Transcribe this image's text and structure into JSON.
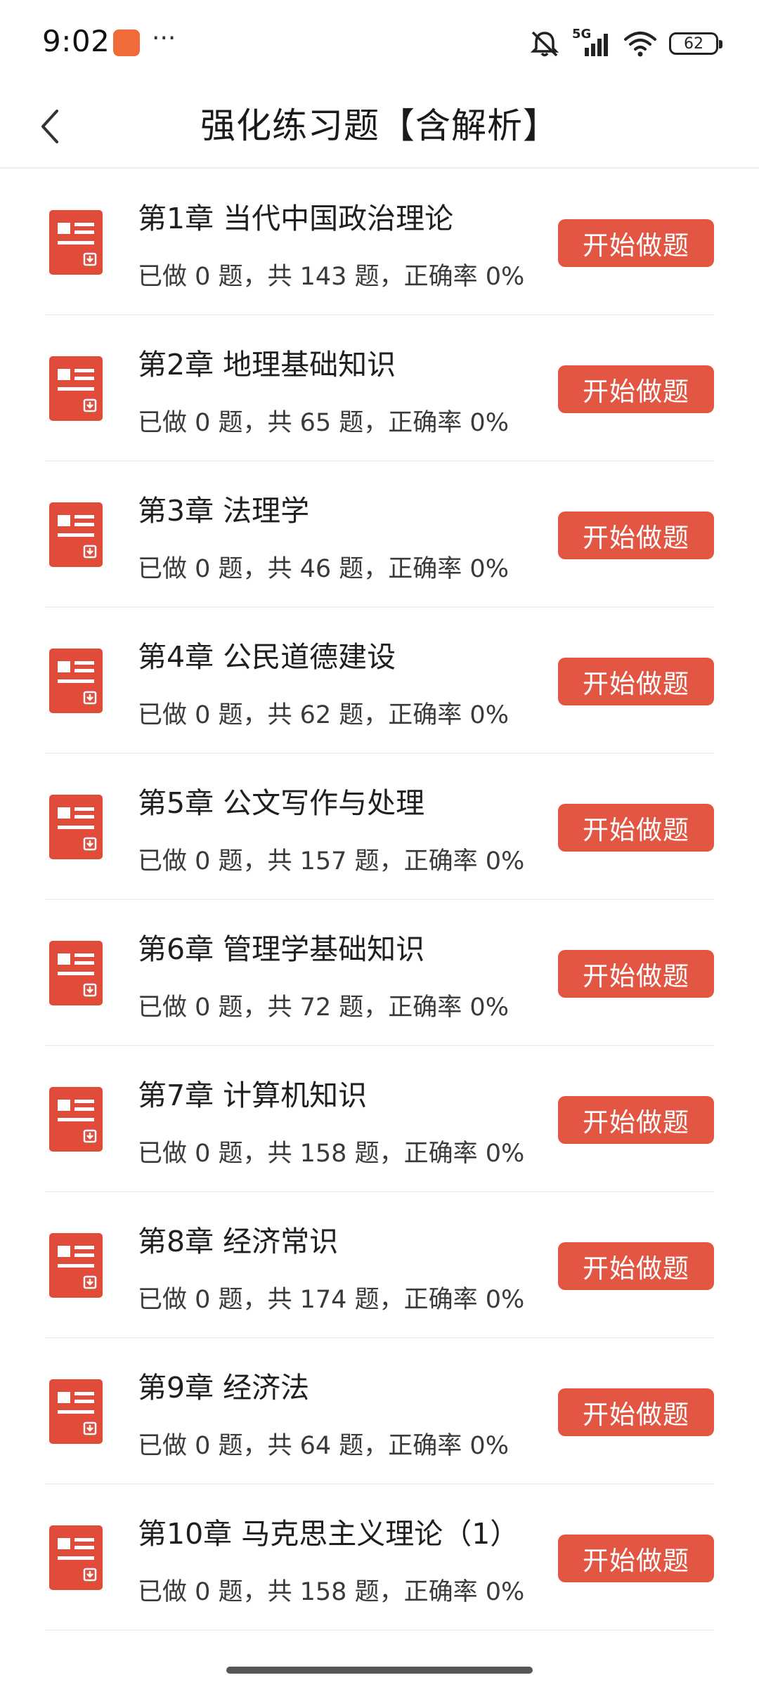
{
  "status_bar": {
    "time": "9:02",
    "more": "···",
    "network": "5G",
    "battery": "62",
    "icons": [
      "app-notification-icon",
      "mute-icon",
      "cellular-signal-icon",
      "wifi-icon",
      "battery-icon"
    ]
  },
  "header": {
    "title": "强化练习题【含解析】",
    "back_icon": "chevron-left-icon"
  },
  "theme": {
    "accent": "#e25643",
    "icon_color": "#e04b3a"
  },
  "chapters": [
    {
      "title": "第1章 当代中国政治理论",
      "stats": "已做 0 题，共 143 题，正确率 0%",
      "button": "开始做题"
    },
    {
      "title": "第2章 地理基础知识",
      "stats": "已做 0 题，共 65 题，正确率 0%",
      "button": "开始做题"
    },
    {
      "title": "第3章 法理学",
      "stats": "已做 0 题，共 46 题，正确率 0%",
      "button": "开始做题"
    },
    {
      "title": "第4章 公民道德建设",
      "stats": "已做 0 题，共 62 题，正确率 0%",
      "button": "开始做题"
    },
    {
      "title": "第5章 公文写作与处理",
      "stats": "已做 0 题，共 157 题，正确率 0%",
      "button": "开始做题"
    },
    {
      "title": "第6章 管理学基础知识",
      "stats": "已做 0 题，共 72 题，正确率 0%",
      "button": "开始做题"
    },
    {
      "title": "第7章 计算机知识",
      "stats": "已做 0 题，共 158 题，正确率 0%",
      "button": "开始做题"
    },
    {
      "title": "第8章 经济常识",
      "stats": "已做 0 题，共 174 题，正确率 0%",
      "button": "开始做题"
    },
    {
      "title": "第9章 经济法",
      "stats": "已做 0 题，共 64 题，正确率 0%",
      "button": "开始做题"
    },
    {
      "title": "第10章 马克思主义理论（1）",
      "stats": "已做 0 题，共 158 题，正确率 0%",
      "button": "开始做题"
    }
  ]
}
